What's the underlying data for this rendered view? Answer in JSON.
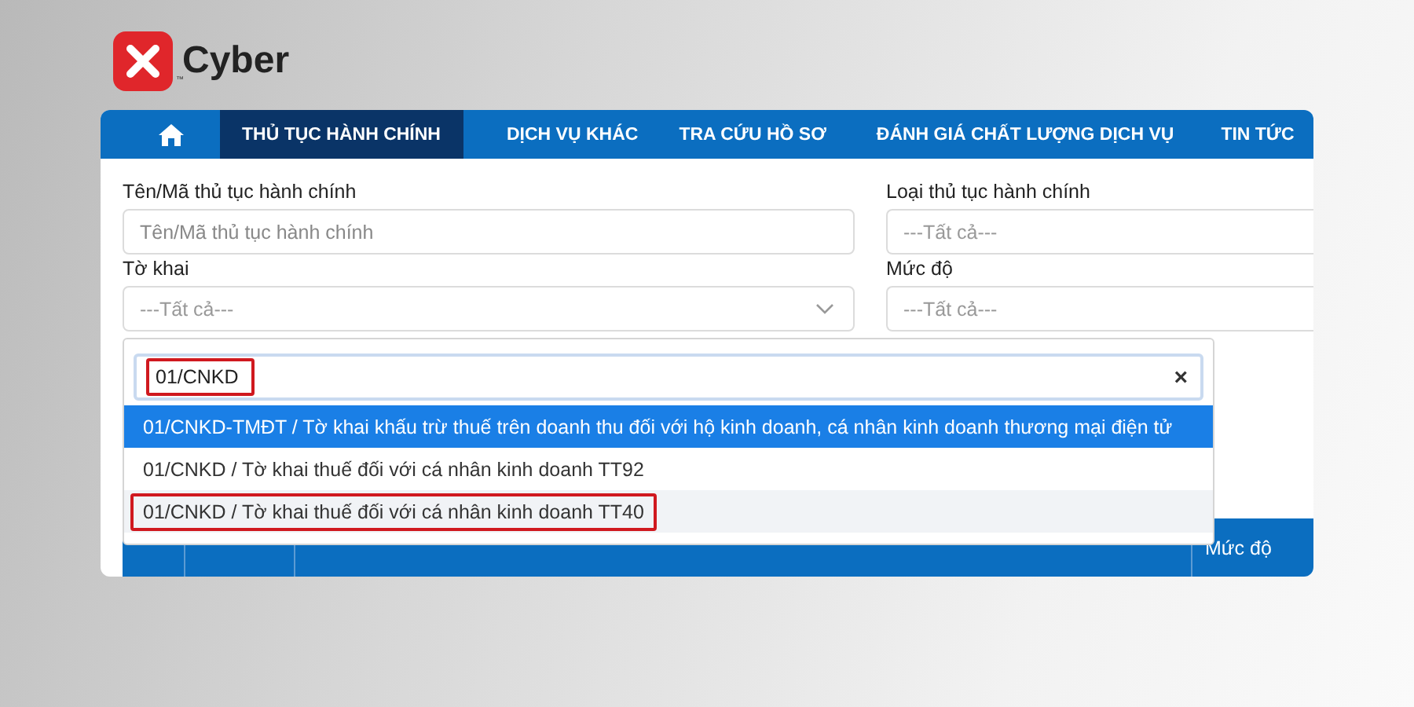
{
  "logo": {
    "name": "Cyber",
    "trademark": "™"
  },
  "nav": [
    {
      "kind": "home",
      "selected": false
    },
    {
      "kind": "link",
      "label": "THỦ TỤC HÀNH CHÍNH",
      "selected": true
    },
    {
      "kind": "link",
      "label": "DỊCH VỤ KHÁC",
      "selected": false
    },
    {
      "kind": "link",
      "label": "TRA CỨU HỒ SƠ",
      "selected": false
    },
    {
      "kind": "link",
      "label": "ĐÁNH GIÁ CHẤT LƯỢNG DỊCH VỤ",
      "selected": false
    },
    {
      "kind": "link",
      "label": "TIN TỨC",
      "selected": false
    }
  ],
  "fields": [
    {
      "kind": "text",
      "label": "Tên/Mã thủ tục hành chính",
      "placeholder": "Tên/Mã thủ tục hành chính"
    },
    {
      "kind": "select",
      "label": "Loại thủ tục hành chính",
      "placeholder": "---Tất cả---"
    },
    {
      "kind": "select",
      "label": "Tờ khai",
      "placeholder": "---Tất cả---",
      "caret": true
    },
    {
      "kind": "select",
      "label": "Mức độ",
      "placeholder": "---Tất cả---"
    }
  ],
  "dropdown": {
    "search": {
      "value": "01/CNKD",
      "marked": true
    },
    "clear": "×",
    "options": [
      {
        "label": "01/CNKD-TMĐT / Tờ khai khấu trừ thuế trên doanh thu đối với hộ kinh doanh, cá nhân kinh doanh thương mại điện tử",
        "selected": true,
        "hovered": false,
        "marked": false
      },
      {
        "label": "01/CNKD / Tờ khai thuế đối với cá nhân kinh doanh TT92",
        "selected": false,
        "hovered": false,
        "marked": false
      },
      {
        "label": "01/CNKD / Tờ khai thuế đối với cá nhân kinh doanh TT40",
        "selected": false,
        "hovered": true,
        "marked": true
      }
    ]
  },
  "table": {
    "columns": [
      {},
      {},
      {},
      {
        "label": "Mức độ"
      }
    ]
  }
}
